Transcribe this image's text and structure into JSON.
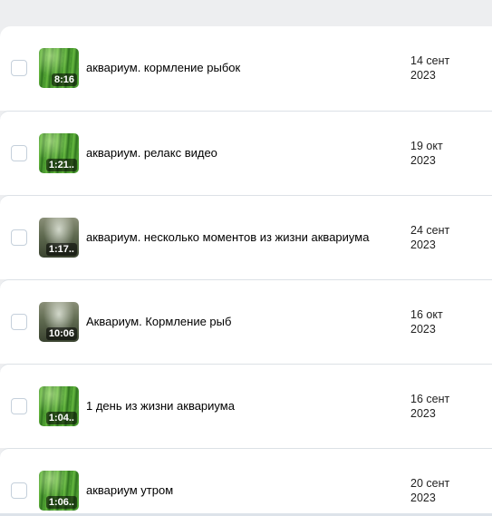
{
  "videos": [
    {
      "title": "аквариум. кормление рыбок",
      "duration": "8:16",
      "date_day": "14 сент",
      "date_year": "2023",
      "thumb": "green"
    },
    {
      "title": "аквариум. релакс видео",
      "duration": "1:21..",
      "date_day": "19 окт",
      "date_year": "2023",
      "thumb": "green"
    },
    {
      "title": "аквариум. несколько моментов из жизни аквариума",
      "duration": "1:17..",
      "date_day": "24 сент",
      "date_year": "2023",
      "thumb": "grey"
    },
    {
      "title": "Аквариум. Кормление рыб",
      "duration": "10:06",
      "date_day": "16 окт",
      "date_year": "2023",
      "thumb": "grey"
    },
    {
      "title": "1 день из жизни аквариума",
      "duration": "1:04..",
      "date_day": "16 сент",
      "date_year": "2023",
      "thumb": "green"
    },
    {
      "title": "аквариум утром",
      "duration": "1:06..",
      "date_day": "20 сент",
      "date_year": "2023",
      "thumb": "green"
    }
  ],
  "colors": {
    "background": "#edeef0",
    "card": "#ffffff",
    "divider": "#dce1e6",
    "checkbox_border": "#c5d0db",
    "text": "#000000"
  }
}
